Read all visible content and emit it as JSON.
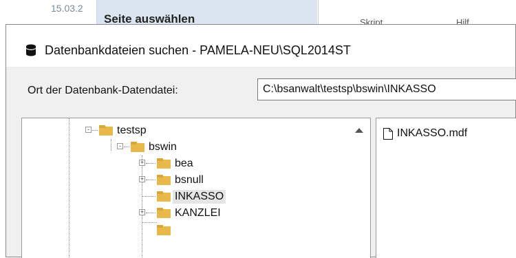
{
  "background": {
    "date": "15.03.2",
    "panel_title": "Seite auswählen",
    "toolbar_items": [
      "Skript",
      "Hilf"
    ]
  },
  "dialog": {
    "title": "Datenbankdateien suchen - PAMELA-NEU\\SQL2014ST",
    "location_label": "Ort der Datenbank-Datendatei:",
    "location_value": "C:\\bsanwalt\\testsp\\bswin\\INKASSO",
    "tree": {
      "nodes": [
        {
          "label": "testsp",
          "expander": "-"
        },
        {
          "label": "bswin",
          "expander": "-"
        },
        {
          "label": "bea",
          "expander": "+"
        },
        {
          "label": "bsnull",
          "expander": "+"
        },
        {
          "label": "INKASSO",
          "expander": "",
          "selected": true
        },
        {
          "label": "KANZLEI",
          "expander": "+"
        }
      ]
    },
    "files": [
      {
        "name": "INKASSO.mdf",
        "icon": "file-icon"
      }
    ]
  },
  "colors": {
    "folder": "#e8b84a",
    "selection": "#e5e5e5",
    "panel": "#dbe5f1"
  }
}
